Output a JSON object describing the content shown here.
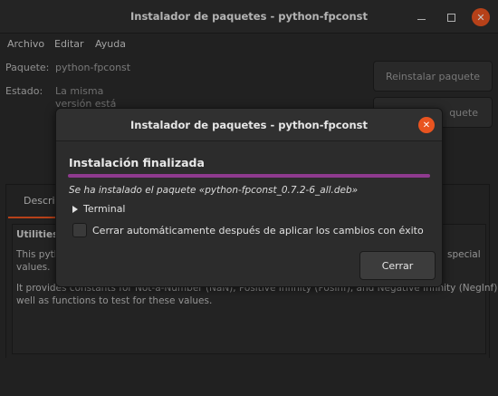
{
  "window": {
    "title": "Instalador de paquetes - python-fpconst",
    "close_glyph": "✕"
  },
  "menu": [
    "Archivo",
    "Editar",
    "Ayuda"
  ],
  "package": {
    "label": "Paquete:",
    "value": "python-fpconst",
    "status_label": "Estado:",
    "status_line1": "La misma",
    "status_line2": "versión está"
  },
  "actions": {
    "reinstall": "Reinstalar paquete",
    "remove_partial": "quete"
  },
  "tabs": {
    "description_partial": "Descri"
  },
  "description": {
    "heading_partial": "Utilities",
    "line1_partial": "This pyth",
    "line1_end": "special",
    "line2": "values.",
    "line3": "It provides constants for Not-a-Number (NaN), Positive Infinity (PosInf), and Negative Infinity (NegInf), as",
    "line4": "well as functions to test for these values."
  },
  "dialog": {
    "title": "Instalador de paquetes - python-fpconst",
    "close_glyph": "✕",
    "heading": "Instalación finalizada",
    "progress_fraction": 1.0,
    "progress_color": "#8e3a8e",
    "message": "Se ha instalado el paquete «python-fpconst_0.7.2-6_all.deb»",
    "expander_label": "Terminal",
    "checkbox_label": "Cerrar automáticamente después de aplicar los cambios con éxito",
    "checkbox_checked": false,
    "close_button": "Cerrar"
  },
  "colors": {
    "accent": "#e95420"
  }
}
